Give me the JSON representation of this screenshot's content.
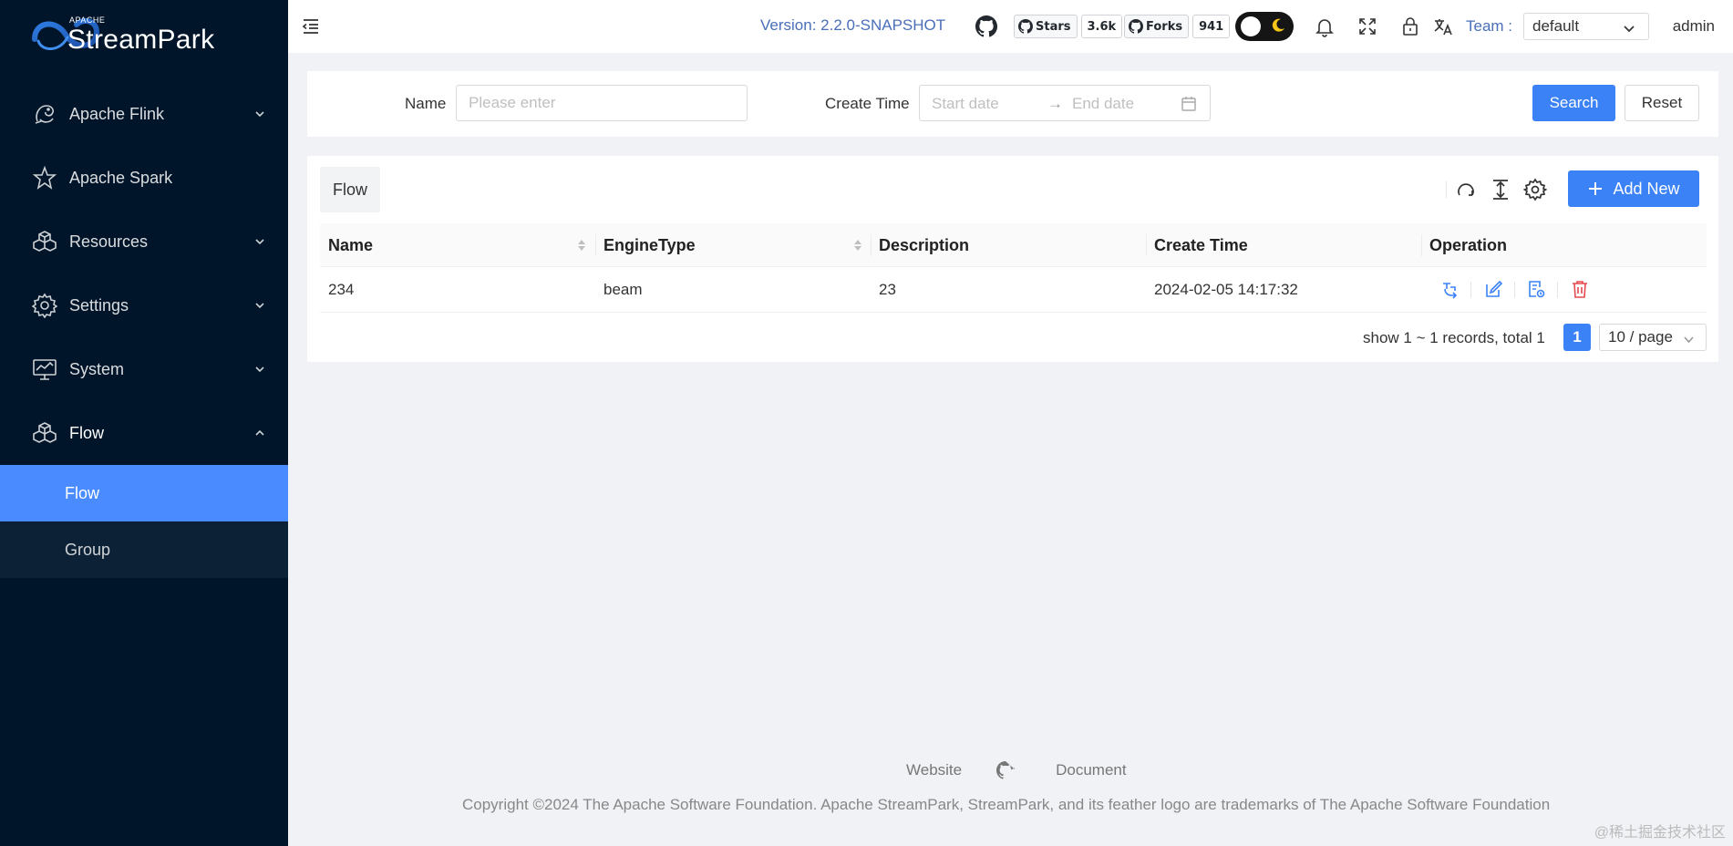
{
  "app": {
    "logo_small": "APACHE",
    "logo_name": "StreamPark"
  },
  "sidebar": {
    "items": [
      {
        "label": "Apache Flink",
        "icon": "flink-squirrel-icon",
        "expandable": true
      },
      {
        "label": "Apache Spark",
        "icon": "spark-star-icon",
        "expandable": false
      },
      {
        "label": "Resources",
        "icon": "cubes-icon",
        "expandable": true
      },
      {
        "label": "Settings",
        "icon": "gear-icon",
        "expandable": true
      },
      {
        "label": "System",
        "icon": "monitor-icon",
        "expandable": true
      },
      {
        "label": "Flow",
        "icon": "cubes-icon",
        "expandable": true,
        "open": true
      }
    ],
    "flow_children": [
      {
        "label": "Flow",
        "active": true
      },
      {
        "label": "Group",
        "active": false
      }
    ]
  },
  "header": {
    "version": "Version: 2.2.0-SNAPSHOT",
    "stars_label": "Stars",
    "stars_count": "3.6k",
    "forks_label": "Forks",
    "forks_count": "941",
    "team_label": "Team :",
    "team_value": "default",
    "user": "admin"
  },
  "search": {
    "name_label": "Name",
    "name_placeholder": "Please enter",
    "create_time_label": "Create Time",
    "start_placeholder": "Start date",
    "end_placeholder": "End date",
    "search_label": "Search",
    "reset_label": "Reset"
  },
  "table": {
    "title": "Flow",
    "add_label": "Add New",
    "columns": [
      "Name",
      "EngineType",
      "Description",
      "Create Time",
      "Operation"
    ],
    "rows": [
      {
        "name": "234",
        "engine": "beam",
        "description": "23",
        "create_time": "2024-02-05 14:17:32"
      }
    ],
    "pagination": {
      "summary": "show 1 ~ 1 records, total 1",
      "current_page": "1",
      "page_size": "10 / page"
    }
  },
  "footer": {
    "website": "Website",
    "document": "Document",
    "copyright": "Copyright ©2024 The Apache Software Foundation. Apache StreamPark, StreamPark, and its feather logo are trademarks of The Apache Software Foundation"
  },
  "watermark": "@稀土掘金技术社区",
  "colors": {
    "sidebar_bg": "#001529",
    "primary": "#3b82f6",
    "active_menu": "#4a8cff",
    "delete": "#e5484d"
  }
}
